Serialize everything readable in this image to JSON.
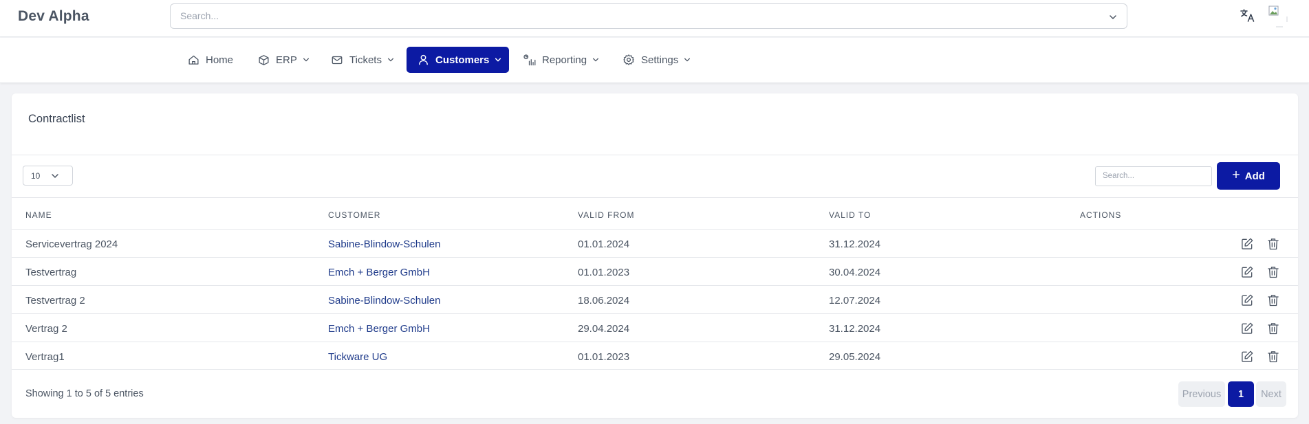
{
  "app": {
    "title": "Dev Alpha"
  },
  "search": {
    "placeholder": "Search..."
  },
  "nav": [
    {
      "label": "Home",
      "icon": "home-icon",
      "dropdown": false
    },
    {
      "label": "ERP",
      "icon": "cube-icon",
      "dropdown": true
    },
    {
      "label": "Tickets",
      "icon": "mail-icon",
      "dropdown": true
    },
    {
      "label": "Customers",
      "icon": "user-icon",
      "dropdown": true,
      "active": true
    },
    {
      "label": "Reporting",
      "icon": "chart-icon",
      "dropdown": true
    },
    {
      "label": "Settings",
      "icon": "gear-icon",
      "dropdown": true
    }
  ],
  "card": {
    "title": "Contractlist"
  },
  "table_controls": {
    "page_length": "10",
    "search_placeholder": "Search...",
    "add_label": "Add"
  },
  "table": {
    "columns": [
      "NAME",
      "CUSTOMER",
      "VALID FROM",
      "VALID TO",
      "ACTIONS"
    ],
    "rows": [
      {
        "name": "Servicevertrag 2024",
        "customer": "Sabine-Blindow-Schulen",
        "valid_from": "01.01.2024",
        "valid_to": "31.12.2024"
      },
      {
        "name": "Testvertrag",
        "customer": "Emch + Berger GmbH",
        "valid_from": "01.01.2023",
        "valid_to": "30.04.2024"
      },
      {
        "name": "Testvertrag 2",
        "customer": "Sabine-Blindow-Schulen",
        "valid_from": "18.06.2024",
        "valid_to": "12.07.2024"
      },
      {
        "name": "Vertrag 2",
        "customer": "Emch + Berger GmbH",
        "valid_from": "29.04.2024",
        "valid_to": "31.12.2024"
      },
      {
        "name": "Vertrag1",
        "customer": "Tickware UG",
        "valid_from": "01.01.2023",
        "valid_to": "29.05.2024"
      }
    ]
  },
  "footer": {
    "info": "Showing 1 to 5 of 5 entries",
    "previous": "Previous",
    "current_page": "1",
    "next": "Next"
  },
  "colors": {
    "primary": "#0c1aa3",
    "link": "#1e3a8a",
    "background": "#f2f3f6"
  },
  "icons": {
    "translate": "translate-icon",
    "edit": "edit-icon",
    "delete": "trash-icon",
    "dropdown": "chevron-down-icon"
  }
}
